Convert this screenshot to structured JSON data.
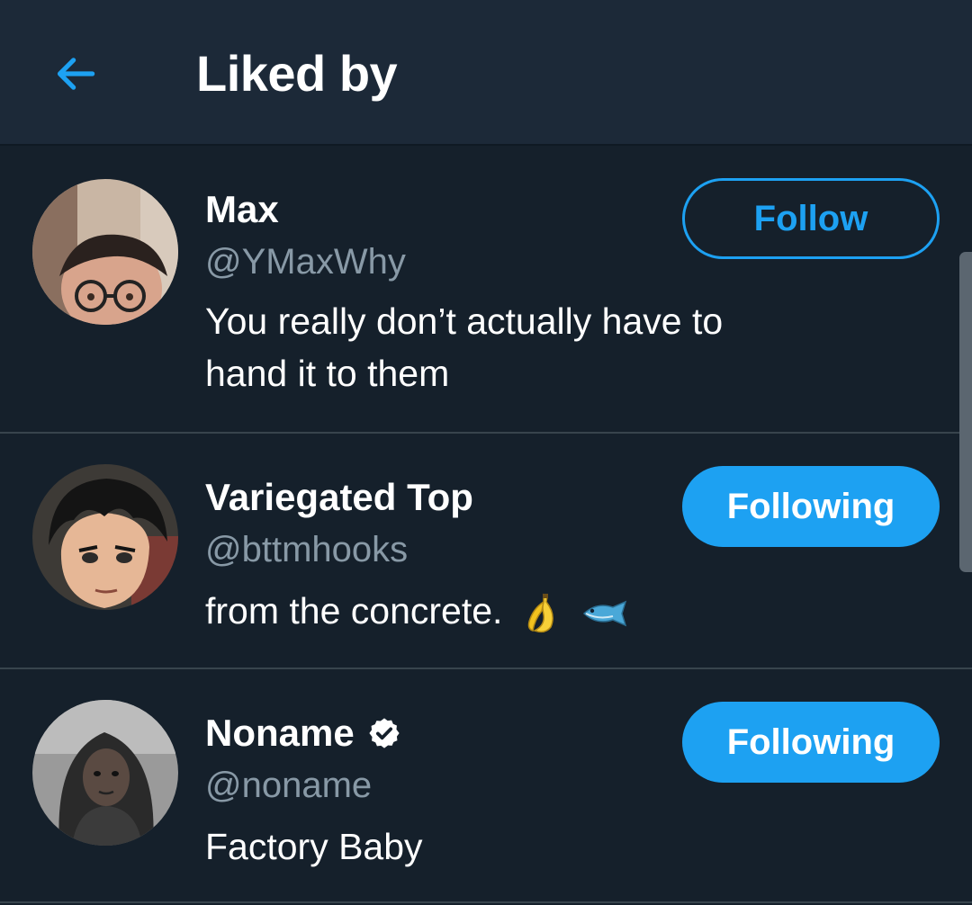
{
  "header": {
    "title": "Liked by",
    "back_icon": "arrow-left-icon",
    "accent_color": "#1da1f2",
    "background": "#1c2938"
  },
  "users": [
    {
      "name": "Max",
      "handle": "@YMaxWhy",
      "bio_lines": [
        "You really don’t actually have to",
        "hand it to them"
      ],
      "verified": false,
      "button": "Follow",
      "button_style": "outline",
      "avatar_icon": "user-photo-avatar"
    },
    {
      "name": "Variegated Top",
      "handle": "@bttmhooks",
      "bio": "from the concrete.",
      "bio_emoji": [
        "banana-icon",
        "fish-icon"
      ],
      "verified": false,
      "button": "Following",
      "button_style": "filled",
      "avatar_icon": "anime-character-avatar"
    },
    {
      "name": "Noname",
      "handle": "@noname",
      "bio": "Factory Baby",
      "verified": true,
      "button": "Following",
      "button_style": "filled",
      "avatar_icon": "user-photo-avatar"
    }
  ],
  "colors": {
    "background": "#15202b",
    "divider": "#38444d",
    "secondary_text": "#8899a6",
    "primary_text": "#ffffff"
  }
}
